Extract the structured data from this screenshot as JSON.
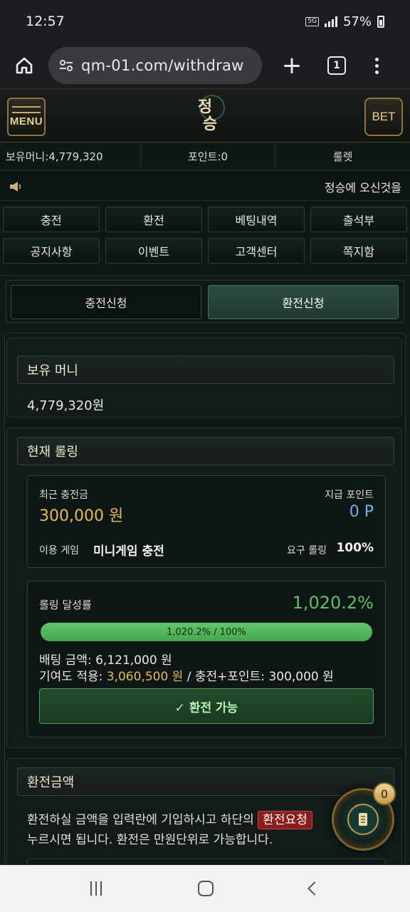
{
  "status_bar": {
    "time": "12:57",
    "network": "5G",
    "battery": "57%"
  },
  "browser": {
    "url": "qm-01.com/withdraw",
    "tab_count": "1"
  },
  "header": {
    "menu_label": "MENU",
    "logo_line1": "정",
    "logo_line2": "승",
    "bet_label": "BET"
  },
  "info_bar": {
    "money": "보유머니:4,779,320",
    "points": "포인트:0",
    "roulette": "룰렛"
  },
  "notice": {
    "text": "정승에 오신것을"
  },
  "nav": {
    "items": [
      "충전",
      "환전",
      "베팅내역",
      "출석부",
      "공지사항",
      "이벤트",
      "고객센터",
      "쪽지함"
    ]
  },
  "request_tabs": {
    "deposit": "충전신청",
    "withdraw": "환전신청"
  },
  "money_section": {
    "title": "보유 머니",
    "value": "4,779,320원"
  },
  "rolling": {
    "title": "현재 롤링",
    "recent_deposit_label": "최근 충전금",
    "recent_deposit_value": "300,000 원",
    "bonus_point_label": "지급 포인트",
    "bonus_point_value": "0 P",
    "game_label": "이용 게임",
    "game_value": "미니게임 충전",
    "required_label": "요구 롤링",
    "required_value": "100%",
    "rate_label": "롤링 달성률",
    "rate_value": "1,020.2%",
    "progress_text": "1,020.2% / 100%",
    "progress_fraction": 1.0,
    "bet_amount_label": "배팅 금액:",
    "bet_amount_value": "6,121,000 원",
    "contribution_label": "기여도 적용:",
    "contribution_value": "3,060,500 원",
    "deposit_points_label": "/ 충전+포인트: 300,000 원",
    "status_button": "✓ 환전 가능"
  },
  "withdraw_section": {
    "title": "환전금액",
    "desc_part1": "환전하실 금액을 입력란에 기입하시고 하단의",
    "desc_highlight": "환전요청",
    "desc_part2": "누르시면 됩니다. 환전은 만원단위로 가능합니다."
  },
  "floating_badge": {
    "count": "0"
  },
  "colors": {
    "accent_green": "#5fbf63",
    "gold": "#e6b85a",
    "blue": "#6fb2e8",
    "highlight_red": "#8a1c1c"
  }
}
